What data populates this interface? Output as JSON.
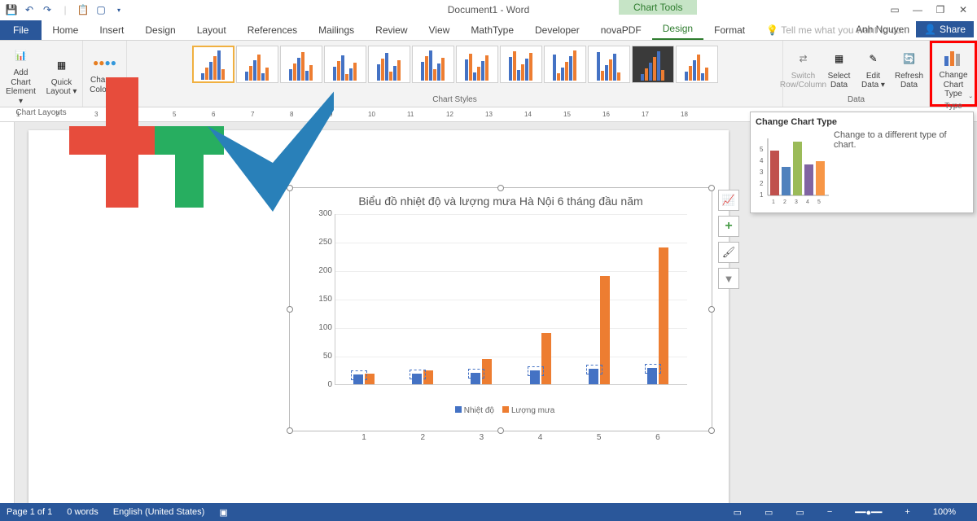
{
  "qat": {
    "doc_title": "Document1 - Word",
    "chart_tools": "Chart Tools"
  },
  "tabs": {
    "file": "File",
    "items": [
      "Home",
      "Insert",
      "Design",
      "Layout",
      "References",
      "Mailings",
      "Review",
      "View",
      "MathType",
      "Developer",
      "novaPDF",
      "Design",
      "Format"
    ],
    "tellme": "Tell me what you want to do..."
  },
  "user": {
    "name": "Anh Nguyen",
    "share": "Share"
  },
  "ribbon": {
    "g1": {
      "btns": [
        "Add Chart Element ▾",
        "Quick Layout ▾"
      ],
      "label": "Chart Layouts"
    },
    "g2": {
      "btns": [
        "Change Colors ▾"
      ],
      "label": ""
    },
    "g3": {
      "label": "Chart Styles"
    },
    "g4": {
      "btns": [
        "Switch Row/Column",
        "Select Data",
        "Edit Data ▾",
        "Refresh Data"
      ],
      "label": "Data"
    },
    "g5": {
      "btns": [
        "Change Chart Type"
      ],
      "label": "Type"
    }
  },
  "tooltip": {
    "title": "Change Chart Type",
    "desc": "Change to a different type of chart."
  },
  "status": {
    "page": "Page 1 of 1",
    "words": "0 words",
    "lang": "English (United States)",
    "zoom": "100%"
  },
  "chart_data": {
    "type": "bar",
    "title": "Biểu đồ nhiệt độ và lượng mưa Hà Nội 6 tháng đầu năm",
    "categories": [
      "1",
      "2",
      "3",
      "4",
      "5",
      "6"
    ],
    "series": [
      {
        "name": "Nhiệt độ",
        "values": [
          17,
          18,
          20,
          24,
          27,
          28
        ],
        "color": "#4472c4"
      },
      {
        "name": "Lượng mưa",
        "values": [
          18,
          25,
          45,
          90,
          190,
          240
        ],
        "color": "#ed7d31"
      }
    ],
    "ylim": [
      0,
      300
    ],
    "yticks": [
      0,
      50,
      100,
      150,
      200,
      250,
      300
    ],
    "xlabel": "",
    "ylabel": ""
  }
}
